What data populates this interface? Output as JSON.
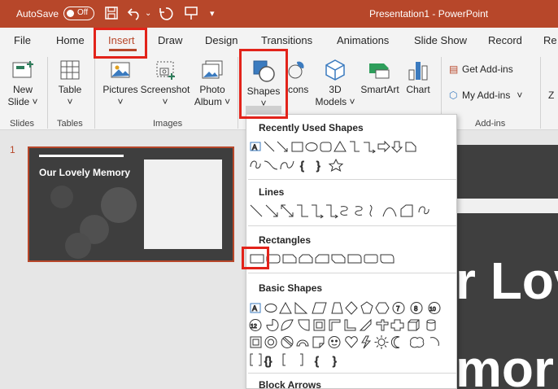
{
  "titlebar": {
    "autosave_label": "AutoSave",
    "autosave_state": "Off",
    "document_title": "Presentation1  -  PowerPoint",
    "icons": [
      "save-icon",
      "undo-icon",
      "redo-icon",
      "present-icon",
      "customize-icon"
    ]
  },
  "tabs": [
    "File",
    "Home",
    "Insert",
    "Draw",
    "Design",
    "Transitions",
    "Animations",
    "Slide Show",
    "Record",
    "Re"
  ],
  "active_tab": "Insert",
  "ribbon": {
    "new_slide": "New",
    "new_slide2": "Slide ˅",
    "table": "Table",
    "pictures": "Pictures",
    "screenshot": "Screenshot",
    "photo_album": "Photo",
    "photo_album2": "Album ˅",
    "shapes": "Shapes",
    "icons": "Icons",
    "models": "3D",
    "models2": "Models ˅",
    "smartart": "SmartArt",
    "chart": "Chart",
    "get_addins": "Get Add-ins",
    "my_addins": "My Add-ins",
    "right_edge": "Z",
    "groups": {
      "slides": "Slides",
      "tables": "Tables",
      "images": "Images",
      "addins": "Add-ins"
    }
  },
  "slide_panel": {
    "slide_number": "1",
    "thumb_title": "Our Lovely Memory"
  },
  "slide_big_text": {
    "line1": "r Lov",
    "line2": "mor"
  },
  "dropdown": {
    "recently_used": "Recently Used Shapes",
    "lines": "Lines",
    "rectangles": "Rectangles",
    "basic_shapes": "Basic Shapes",
    "block_arrows": "Block Arrows"
  },
  "colors": {
    "accent": "#b7472a",
    "highlight": "#e2231a",
    "ribbon": "#f3f3f3"
  }
}
